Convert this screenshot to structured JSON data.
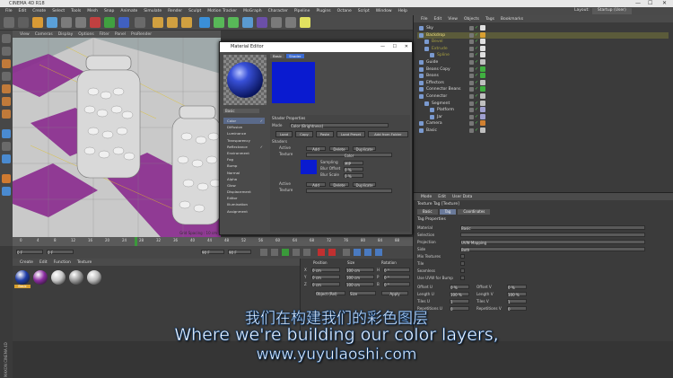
{
  "window": {
    "title": "CINEMA 4D R18",
    "ctrl_min": "—",
    "ctrl_max": "☐",
    "ctrl_close": "✕"
  },
  "menubar": [
    "File",
    "Edit",
    "Create",
    "Select",
    "Tools",
    "Mesh",
    "Snap",
    "Animate",
    "Simulate",
    "Render",
    "Sculpt",
    "Motion Tracker",
    "MoGraph",
    "Character",
    "Pipeline",
    "Plugins",
    "Octane",
    "Script",
    "Window",
    "Help"
  ],
  "layout": {
    "label": "Layout:",
    "value": "Startup (User)"
  },
  "viewport": {
    "menu": [
      "View",
      "Cameras",
      "Display",
      "Options",
      "Filter",
      "Panel",
      "ProRender"
    ],
    "grid_label": "Grid Spacing : 10 cm"
  },
  "timeline": {
    "ticks": [
      "0",
      "4",
      "8",
      "12",
      "16",
      "20",
      "24",
      "28",
      "32",
      "36",
      "40",
      "44",
      "48",
      "52",
      "56",
      "60",
      "64",
      "68",
      "72",
      "76",
      "80",
      "84",
      "88"
    ],
    "frame_field": "0 F",
    "end_field": "90 F",
    "start_field": "0 F",
    "end_field2": "90 F"
  },
  "materials": {
    "menu": [
      "Create",
      "Edit",
      "Function",
      "Texture"
    ],
    "items": [
      {
        "name": "Basic",
        "color": "#1f3da8"
      },
      {
        "name": "",
        "color": "#8a2ca0"
      },
      {
        "name": "",
        "color": "#c8c8c8"
      },
      {
        "name": "",
        "color": "#9a9a9a"
      },
      {
        "name": "",
        "color": "#bbbbbb"
      }
    ]
  },
  "coords": {
    "headers": [
      "Position",
      "Size",
      "Rotation"
    ],
    "rows": [
      {
        "axis": "X",
        "pos": "0 cm",
        "size": "100 cm",
        "rot_axis": "H",
        "rot": "0 °"
      },
      {
        "axis": "Y",
        "pos": "0 cm",
        "size": "100 cm",
        "rot_axis": "P",
        "rot": "0 °"
      },
      {
        "axis": "Z",
        "pos": "0 cm",
        "size": "100 cm",
        "rot_axis": "B",
        "rot": "0 °"
      }
    ],
    "mode": "Object (Rel)",
    "size_mode": "Size",
    "apply": "Apply"
  },
  "objects": {
    "menu": [
      "File",
      "Edit",
      "View",
      "Objects",
      "Tags",
      "Bookmarks"
    ],
    "items": [
      {
        "name": "Sky",
        "indent": 0
      },
      {
        "name": "Backdrop",
        "indent": 0
      },
      {
        "name": "Bevel",
        "indent": 1
      },
      {
        "name": "Extrude",
        "indent": 1
      },
      {
        "name": "Spline",
        "indent": 2
      },
      {
        "name": "Guide",
        "indent": 0
      },
      {
        "name": "Beans Copy",
        "indent": 0
      },
      {
        "name": "Beans",
        "indent": 0
      },
      {
        "name": "Effectors",
        "indent": 0
      },
      {
        "name": "Connector Beans",
        "indent": 0
      },
      {
        "name": "Connector",
        "indent": 0
      },
      {
        "name": "Segment",
        "indent": 1
      },
      {
        "name": "Platform",
        "indent": 2
      },
      {
        "name": "Jar",
        "indent": 2
      },
      {
        "name": "Camera",
        "indent": 0
      },
      {
        "name": "Basic",
        "indent": 0
      }
    ]
  },
  "attributes": {
    "menu": [
      "Mode",
      "Edit",
      "User Data"
    ],
    "title": "Texture Tag [Texture]",
    "tabs": [
      "Basic",
      "Tag",
      "Coordinates"
    ],
    "section": "Tag Properties",
    "rows": [
      {
        "label": "Material",
        "value": "Basic"
      },
      {
        "label": "Selection",
        "value": ""
      },
      {
        "label": "Projection",
        "value": "UVW Mapping"
      },
      {
        "label": "Side",
        "value": "Both"
      },
      {
        "label": "Mix Textures",
        "value": ""
      },
      {
        "label": "Tile",
        "value": ""
      },
      {
        "label": "Seamless",
        "value": ""
      },
      {
        "label": "Use UVW for Bump",
        "value": ""
      }
    ],
    "offsets": [
      {
        "l": "Offset U",
        "v": "0 %",
        "l2": "Offset V",
        "v2": "0 %"
      },
      {
        "l": "Length U",
        "v": "100 %",
        "l2": "Length V",
        "v2": "100 %"
      },
      {
        "l": "Tiles U",
        "v": "1",
        "l2": "Tiles V",
        "v2": "1"
      },
      {
        "l": "Repetitions U",
        "v": "0",
        "l2": "Repetitions V",
        "v2": "0"
      }
    ]
  },
  "material_editor": {
    "title": "Material Editor",
    "swatch_tabs": [
      "Basic",
      "Shader"
    ],
    "name": "Basic",
    "channels": [
      {
        "name": "Color",
        "on": true
      },
      {
        "name": "Diffusion",
        "on": false
      },
      {
        "name": "Luminance",
        "on": false
      },
      {
        "name": "Transparency",
        "on": false
      },
      {
        "name": "Reflectance",
        "on": true
      },
      {
        "name": "Environment",
        "on": false
      },
      {
        "name": "Fog",
        "on": false
      },
      {
        "name": "Bump",
        "on": false
      },
      {
        "name": "Normal",
        "on": false
      },
      {
        "name": "Alpha",
        "on": false
      },
      {
        "name": "Glow",
        "on": false
      },
      {
        "name": "Displacement",
        "on": false
      },
      {
        "name": "Editor",
        "on": false
      },
      {
        "name": "Illumination",
        "on": false
      },
      {
        "name": "Assignment",
        "on": false
      }
    ],
    "shader_section": "Shader Properties",
    "mode_label": "Mode",
    "mode_value": "Color (Brightness)",
    "buttons": [
      "Load",
      "Copy",
      "Paste",
      "Load Preset",
      "Add from Folder"
    ],
    "shaders_label": "Shaders",
    "active_label": "Active",
    "btn_add": "Add",
    "btn_delete": "Delete",
    "btn_duplicate": "Duplicate",
    "texture_label": "Texture",
    "texture_value": "Color",
    "sampling_label": "Sampling",
    "sampling_value": "MIP",
    "blur_offset_label": "Blur Offset",
    "blur_offset_value": "0 %",
    "blur_scale_label": "Blur Scale",
    "blur_scale_value": "0 %",
    "preview_color": "#0a1bd0"
  },
  "subtitles": {
    "cn": "我们在构建我们的彩色图层",
    "en": "Where we're building our color layers,",
    "url": "www.yuyulaoshi.com"
  },
  "brand": "MAXON CINEMA 4D"
}
